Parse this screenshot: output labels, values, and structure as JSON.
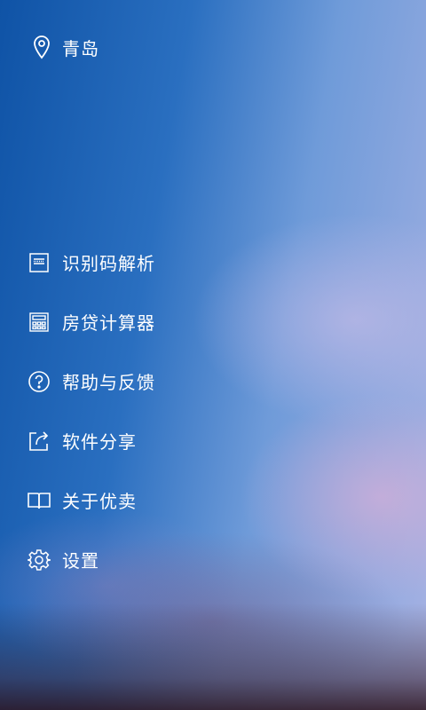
{
  "location": {
    "city": "青岛",
    "icon": "location-pin-icon"
  },
  "menu": {
    "items": [
      {
        "label": "识别码解析",
        "icon": "barcode-scan-icon"
      },
      {
        "label": "房贷计算器",
        "icon": "calculator-icon"
      },
      {
        "label": "帮助与反馈",
        "icon": "help-icon"
      },
      {
        "label": "软件分享",
        "icon": "share-icon"
      },
      {
        "label": "关于优卖",
        "icon": "book-icon"
      },
      {
        "label": "设置",
        "icon": "gear-icon"
      }
    ]
  },
  "colors": {
    "text": "#ffffff",
    "background_top": "#0f53a6",
    "background_right": "#a7b2e3"
  }
}
